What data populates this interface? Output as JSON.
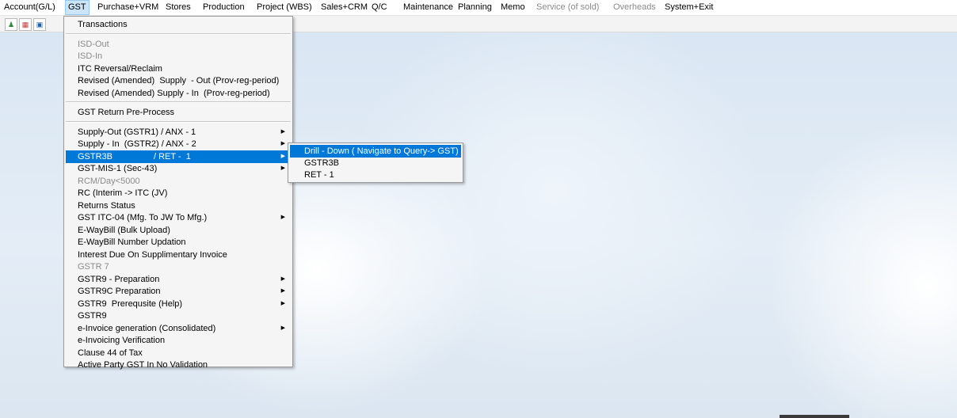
{
  "menubar": [
    {
      "label": "Account(G/L)",
      "state": "normal"
    },
    {
      "label": "GST",
      "state": "active"
    },
    {
      "label": "Purchase+VRM",
      "state": "normal"
    },
    {
      "label": "Stores",
      "state": "normal"
    },
    {
      "label": "Production",
      "state": "normal"
    },
    {
      "label": "Project (WBS)",
      "state": "normal"
    },
    {
      "label": "Sales+CRM",
      "state": "normal"
    },
    {
      "label": "Q/C",
      "state": "normal"
    },
    {
      "label": "Maintenance",
      "state": "normal"
    },
    {
      "label": "Planning",
      "state": "normal"
    },
    {
      "label": "Memo",
      "state": "normal"
    },
    {
      "label": "Service (of sold)",
      "state": "disabled"
    },
    {
      "label": "Overheads",
      "state": "disabled"
    },
    {
      "label": "System+Exit",
      "state": "normal"
    }
  ],
  "toolbar": {
    "buttons": [
      "people-icon",
      "chart-icon",
      "book-icon"
    ]
  },
  "gst_menu": {
    "items": [
      {
        "label": "Transactions",
        "enabled": true,
        "submenu": false
      },
      {
        "separator": true
      },
      {
        "label": "ISD-Out",
        "enabled": false,
        "submenu": false
      },
      {
        "label": "ISD-In",
        "enabled": false,
        "submenu": false
      },
      {
        "label": "ITC Reversal/Reclaim",
        "enabled": true,
        "submenu": false
      },
      {
        "label": "Revised (Amended)  Supply  - Out (Prov-reg-period)",
        "enabled": true,
        "submenu": false
      },
      {
        "label": "Revised (Amended) Supply - In  (Prov-reg-period)",
        "enabled": true,
        "submenu": false
      },
      {
        "separator": true
      },
      {
        "label": "GST Return Pre-Process",
        "enabled": true,
        "submenu": false
      },
      {
        "separator": true
      },
      {
        "label": "Supply-Out (GSTR1) / ANX - 1",
        "enabled": true,
        "submenu": true
      },
      {
        "label": "Supply - In  (GSTR2) / ANX - 2",
        "enabled": true,
        "submenu": true
      },
      {
        "label": "GSTR3B                 / RET -  1",
        "enabled": true,
        "submenu": true,
        "highlighted": true
      },
      {
        "label": "GST-MIS-1 (Sec-43)",
        "enabled": true,
        "submenu": true
      },
      {
        "label": "RCM/Day<5000",
        "enabled": false,
        "submenu": false
      },
      {
        "label": "RC (Interim -> ITC (JV)",
        "enabled": true,
        "submenu": false
      },
      {
        "label": "Returns Status",
        "enabled": true,
        "submenu": false
      },
      {
        "label": "GST ITC-04 (Mfg. To JW To Mfg.)",
        "enabled": true,
        "submenu": true
      },
      {
        "label": "E-WayBill (Bulk Upload)",
        "enabled": true,
        "submenu": false
      },
      {
        "label": "E-WayBill Number Updation",
        "enabled": true,
        "submenu": false
      },
      {
        "label": "Interest Due On Supplimentary Invoice",
        "enabled": true,
        "submenu": false
      },
      {
        "label": "GSTR 7",
        "enabled": false,
        "submenu": false
      },
      {
        "label": "GSTR9 - Preparation",
        "enabled": true,
        "submenu": true
      },
      {
        "label": "GSTR9C Preparation",
        "enabled": true,
        "submenu": true
      },
      {
        "label": "GSTR9  Prerequsite (Help)",
        "enabled": true,
        "submenu": true
      },
      {
        "label": "GSTR9",
        "enabled": true,
        "submenu": false
      },
      {
        "label": "e-Invoice generation (Consolidated)",
        "enabled": true,
        "submenu": true
      },
      {
        "label": "e-Invoicing Verification",
        "enabled": true,
        "submenu": false
      },
      {
        "label": "Clause 44 of Tax",
        "enabled": true,
        "submenu": false
      },
      {
        "label": "Active Party GST In No Validation",
        "enabled": true,
        "submenu": false
      }
    ]
  },
  "submenu": {
    "items": [
      {
        "label": "Drill - Down ( Navigate to Query-> GST)",
        "highlighted": true
      },
      {
        "label": "GSTR3B",
        "highlighted": false
      },
      {
        "label": "RET - 1",
        "highlighted": false
      }
    ]
  },
  "icons": {
    "submenu_arrow": "▶"
  },
  "colors": {
    "highlight": "#0078d7",
    "disabled": "#8a8a8a",
    "menubar_active": "#cce4f7"
  }
}
